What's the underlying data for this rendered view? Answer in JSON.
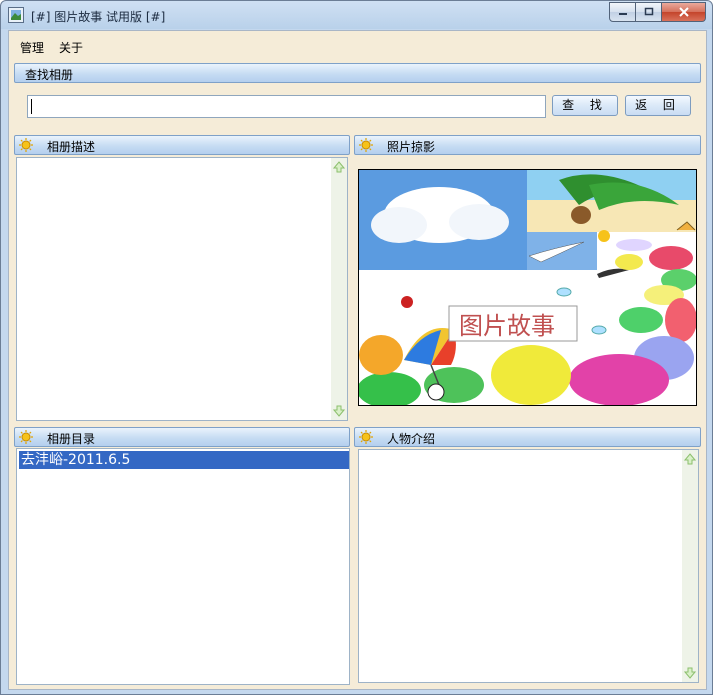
{
  "window": {
    "title": "[#] 图片故事 试用版 [#]"
  },
  "menu": {
    "items": [
      "管理",
      "关于"
    ]
  },
  "search": {
    "header": "查找相册",
    "input_value": "",
    "find_label": "查 找",
    "back_label": "返 回"
  },
  "panels": {
    "description": {
      "title": "相册描述"
    },
    "photo": {
      "title": "照片掠影",
      "logo_text": "图片故事"
    },
    "catalog": {
      "title": "相册目录",
      "items": [
        "去沣峪-2011.6.5"
      ]
    },
    "people": {
      "title": "人物介绍"
    }
  },
  "icons": {
    "app": "app-icon",
    "header": "sun-icon",
    "scroll_up": "up-arrow-icon",
    "scroll_down": "down-arrow-icon"
  },
  "colors": {
    "selection": "#3468c4",
    "client_bg": "#f5ecd8",
    "header_border": "#7fa1c8"
  }
}
